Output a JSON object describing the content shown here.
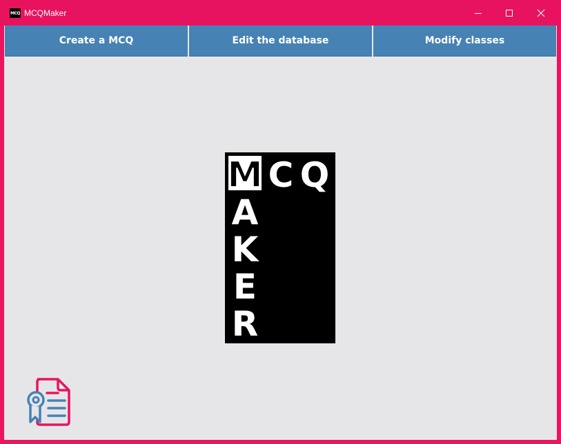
{
  "window": {
    "title": "MCQMaker",
    "icon_label": "MCQ",
    "accent_color": "#e8135f"
  },
  "toolbar": {
    "buttons": [
      {
        "label": "Create a MCQ"
      },
      {
        "label": "Edit the database"
      },
      {
        "label": "Modify classes"
      }
    ],
    "button_color": "#4682b4"
  },
  "logo": {
    "top_text": "MCQ",
    "side_text": "MAKER"
  },
  "icons": {
    "minimize": "minimize-icon",
    "maximize": "maximize-icon",
    "close": "close-icon",
    "certificate": "certificate-icon"
  }
}
